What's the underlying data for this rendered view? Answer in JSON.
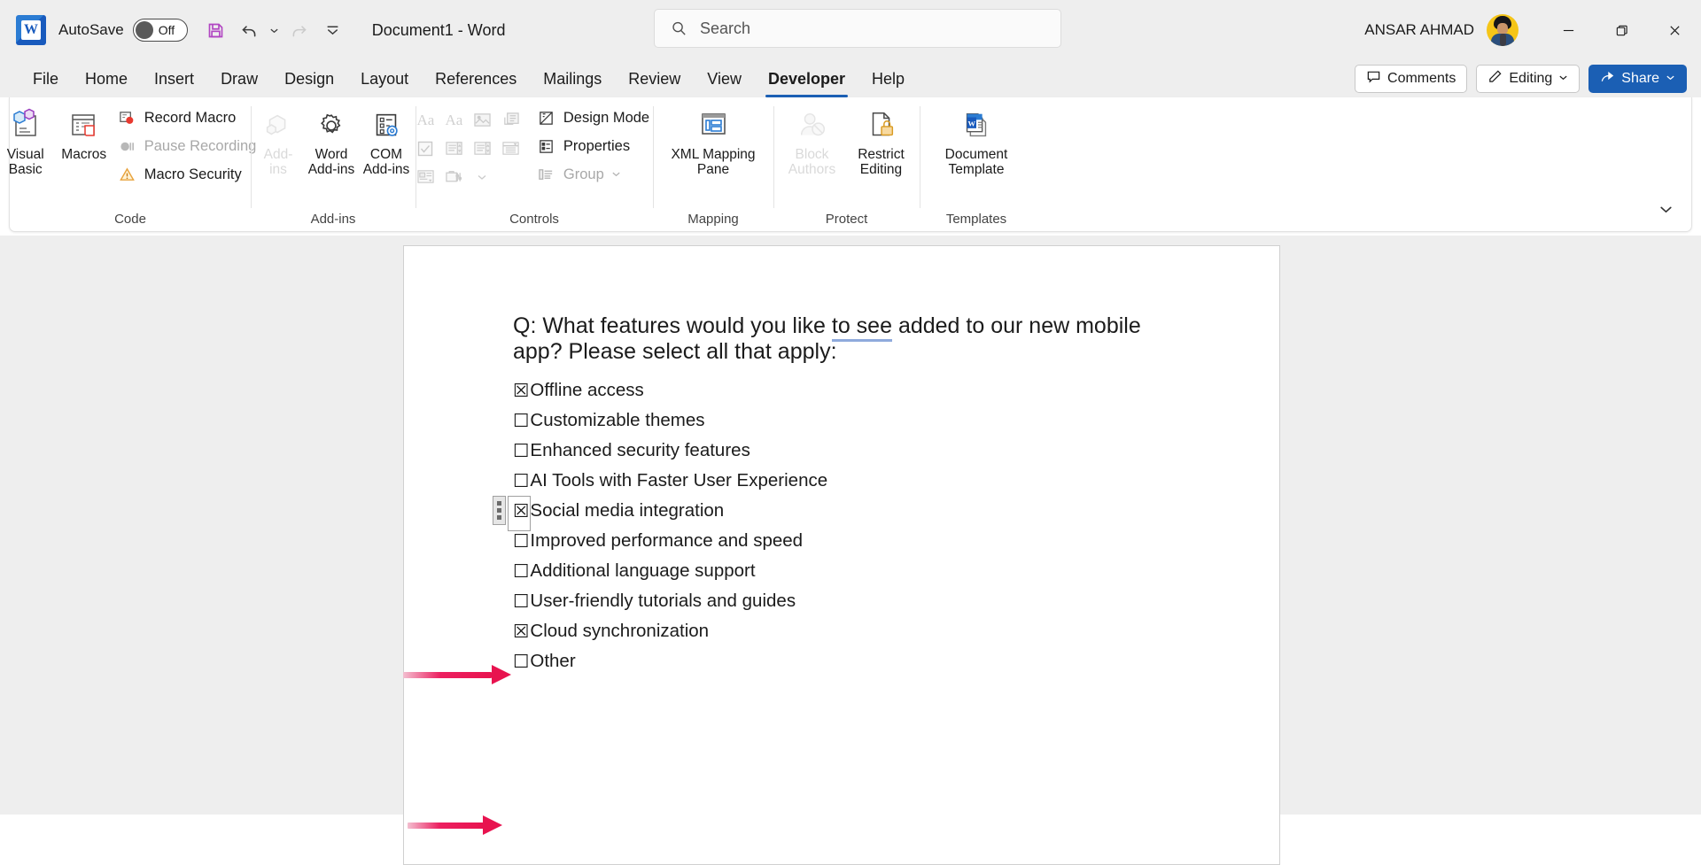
{
  "app": {
    "logo_letter": "W",
    "title": "Document1  -  Word",
    "autosave_label": "AutoSave",
    "autosave_state": "Off",
    "user_name": "ANSAR AHMAD"
  },
  "quick_access": [
    {
      "name": "save-icon",
      "label": "Save",
      "enabled": true
    },
    {
      "name": "undo-icon",
      "label": "Undo",
      "enabled": true
    },
    {
      "name": "redo-icon",
      "label": "Redo",
      "enabled": false
    },
    {
      "name": "customize-quick-access-toolbar-icon",
      "label": "Customize Quick Access Toolbar",
      "enabled": true
    }
  ],
  "search": {
    "placeholder": "Search",
    "icon": "search-icon"
  },
  "window_controls": {
    "minimize": "minimize-icon",
    "restore": "restore-icon",
    "close": "close-icon"
  },
  "tabs": [
    {
      "label": "File",
      "active": false
    },
    {
      "label": "Home",
      "active": false
    },
    {
      "label": "Insert",
      "active": false
    },
    {
      "label": "Draw",
      "active": false
    },
    {
      "label": "Design",
      "active": false
    },
    {
      "label": "Layout",
      "active": false
    },
    {
      "label": "References",
      "active": false
    },
    {
      "label": "Mailings",
      "active": false
    },
    {
      "label": "Review",
      "active": false
    },
    {
      "label": "View",
      "active": false
    },
    {
      "label": "Developer",
      "active": true
    },
    {
      "label": "Help",
      "active": false
    }
  ],
  "tabbar_actions": {
    "comments": "Comments",
    "editing": "Editing",
    "share": "Share"
  },
  "ribbon": {
    "collapse_icon": "chevron-down-icon",
    "groups": [
      {
        "label": "Code",
        "big_buttons": [
          {
            "label": "Visual\nBasic",
            "icon": "visual-basic-icon",
            "enabled": true
          },
          {
            "label": "Macros",
            "icon": "macros-icon",
            "enabled": true
          }
        ],
        "small_buttons": [
          {
            "label": "Record Macro",
            "icon": "record-macro-icon",
            "enabled": true
          },
          {
            "label": "Pause Recording",
            "icon": "pause-recording-icon",
            "enabled": false
          },
          {
            "label": "Macro Security",
            "icon": "macro-security-icon",
            "enabled": true
          }
        ]
      },
      {
        "label": "Add-ins",
        "big_buttons": [
          {
            "label": "Add-\nins",
            "icon": "add-ins-icon",
            "enabled": false
          },
          {
            "label": "Word\nAdd-ins",
            "icon": "word-add-ins-icon",
            "enabled": true
          },
          {
            "label": "COM\nAdd-ins",
            "icon": "com-add-ins-icon",
            "enabled": true
          }
        ],
        "small_buttons": []
      },
      {
        "label": "Controls",
        "gallery": [
          "rich-text-content-control-icon",
          "plain-text-content-control-icon",
          "picture-content-control-icon",
          "building-block-gallery-content-control-icon",
          "check-box-content-control-icon",
          "combo-box-content-control-icon",
          "drop-down-list-content-control-icon",
          "date-picker-content-control-icon",
          "repeating-section-content-control-icon",
          "legacy-tools-icon",
          "legacy-tools-chevron-icon"
        ],
        "small_buttons": [
          {
            "label": "Design Mode",
            "icon": "design-mode-icon",
            "enabled": true
          },
          {
            "label": "Properties",
            "icon": "properties-icon",
            "enabled": true
          },
          {
            "label": "Group",
            "icon": "group-icon",
            "enabled": false,
            "chevron": true
          }
        ]
      },
      {
        "label": "Mapping",
        "big_buttons": [
          {
            "label": "XML Mapping\nPane",
            "icon": "xml-mapping-pane-icon",
            "enabled": true
          }
        ],
        "small_buttons": []
      },
      {
        "label": "Protect",
        "big_buttons": [
          {
            "label": "Block\nAuthors",
            "icon": "block-authors-icon",
            "enabled": false,
            "chevron": true
          },
          {
            "label": "Restrict\nEditing",
            "icon": "restrict-editing-icon",
            "enabled": true
          }
        ],
        "small_buttons": []
      },
      {
        "label": "Templates",
        "big_buttons": [
          {
            "label": "Document\nTemplate",
            "icon": "document-template-icon",
            "enabled": true
          }
        ],
        "small_buttons": []
      }
    ]
  },
  "document": {
    "heading_before": "Q: What features would you like ",
    "heading_grammar": "to see",
    "heading_after": " added to our new mobile app? Please select all that apply:",
    "checked_glyph": "☒",
    "unchecked_glyph": "☐",
    "items": [
      {
        "label": "Offline access",
        "checked": true
      },
      {
        "label": "Customizable themes",
        "checked": false
      },
      {
        "label": "Enhanced security features",
        "checked": false
      },
      {
        "label": "AI Tools with Faster User Experience",
        "checked": false
      },
      {
        "label": "Social media integration",
        "checked": true,
        "selected": true
      },
      {
        "label": "Improved performance and speed",
        "checked": false
      },
      {
        "label": "Additional language support",
        "checked": false
      },
      {
        "label": "User-friendly tutorials and guides",
        "checked": false
      },
      {
        "label": "Cloud synchronization",
        "checked": true
      },
      {
        "label": "Other",
        "checked": false
      }
    ]
  },
  "annotations": {
    "arrow_color": "#e8134f",
    "arrows": [
      {
        "name": "annotation-arrow-offline-access"
      },
      {
        "name": "annotation-arrow-social-media-integration"
      }
    ]
  },
  "colors": {
    "accent": "#1b5fb4",
    "chrome": "#eeeeee",
    "page": "#ffffff",
    "grammar_underline": "#8faadc"
  }
}
